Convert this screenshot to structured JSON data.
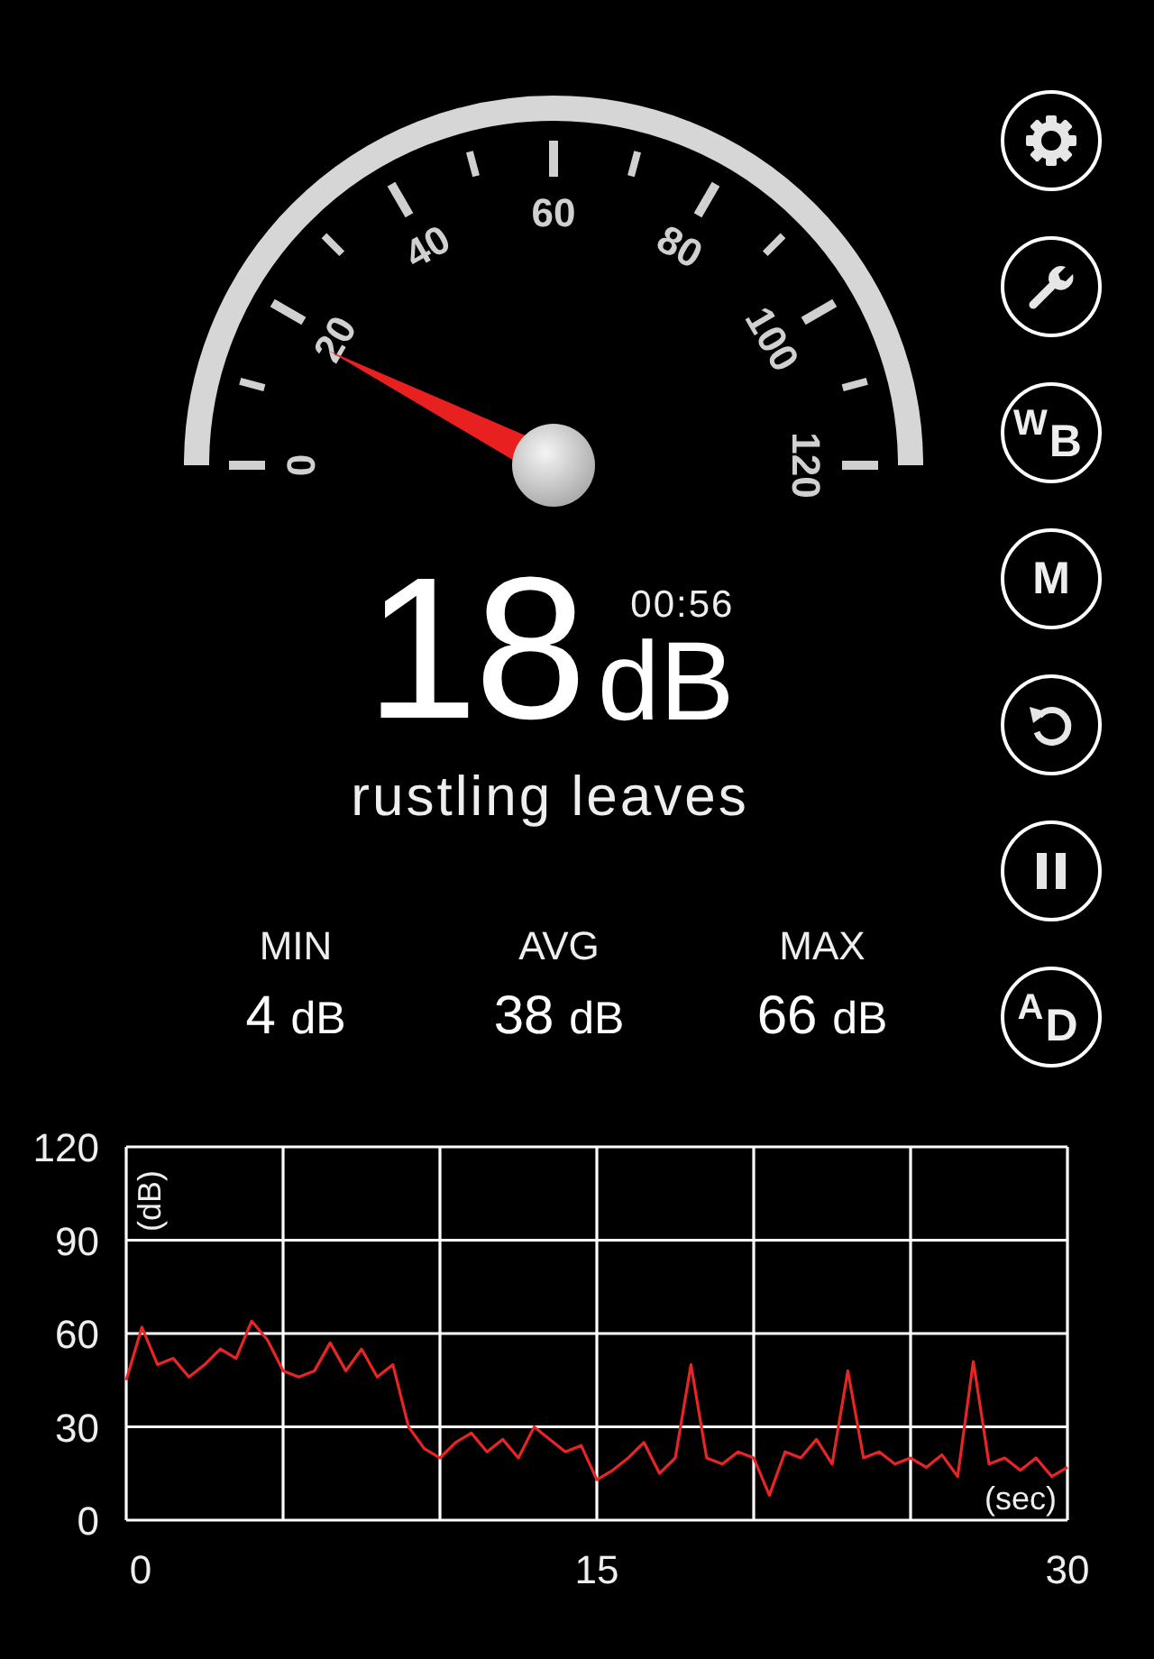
{
  "gauge": {
    "scale": [
      "0",
      "20",
      "40",
      "60",
      "80",
      "100",
      "120"
    ]
  },
  "reading": {
    "value": "18",
    "unit": "dB",
    "timer": "00:56",
    "description": "rustling leaves"
  },
  "stats": [
    {
      "label": "MIN",
      "value": "4",
      "unit": "dB"
    },
    {
      "label": "AVG",
      "value": "38",
      "unit": "dB"
    },
    {
      "label": "MAX",
      "value": "66",
      "unit": "dB"
    }
  ],
  "buttons": [
    {
      "kind": "settings"
    },
    {
      "kind": "wrench"
    },
    {
      "kind": "text",
      "label": "W$_{B}$"
    },
    {
      "kind": "text",
      "label": "M"
    },
    {
      "kind": "reset"
    },
    {
      "kind": "pause"
    },
    {
      "kind": "text",
      "label": "A$_{D}$"
    }
  ],
  "chart": {
    "chart_data": {
      "type": "line",
      "grid": true,
      "xlabel": "(sec)",
      "ylabel": "(dB)",
      "xlim": [
        0,
        30
      ],
      "ylim": [
        0,
        120
      ],
      "xticks": [
        0,
        15,
        30
      ],
      "yticks": [
        0,
        30,
        60,
        90,
        120
      ],
      "x": [
        0,
        0.5,
        1,
        1.5,
        2,
        2.5,
        3,
        3.5,
        4,
        4.5,
        5,
        5.5,
        6,
        6.5,
        7,
        7.5,
        8,
        8.5,
        9,
        9.5,
        10,
        10.5,
        11,
        11.5,
        12,
        12.5,
        13,
        13.5,
        14,
        14.5,
        15,
        15.5,
        16,
        16.5,
        17,
        17.5,
        18,
        18.5,
        19,
        19.5,
        20,
        20.5,
        21,
        21.5,
        22,
        22.5,
        23,
        23.5,
        24,
        24.5,
        25,
        25.5,
        26,
        26.5,
        27,
        27.5,
        28,
        28.5,
        29,
        29.5,
        30
      ],
      "series": [
        {
          "color": "#e82424",
          "values": [
            45,
            62,
            50,
            52,
            46,
            50,
            55,
            52,
            64,
            58,
            48,
            46,
            48,
            57,
            48,
            55,
            46,
            50,
            30,
            23,
            20,
            25,
            28,
            22,
            26,
            20,
            30,
            26,
            22,
            24,
            13,
            16,
            20,
            25,
            15,
            20,
            50,
            20,
            18,
            22,
            20,
            8,
            22,
            20,
            26,
            18,
            48,
            20,
            22,
            18,
            20,
            17,
            21,
            14,
            51,
            18,
            20,
            16,
            20,
            14,
            17
          ]
        }
      ]
    }
  }
}
